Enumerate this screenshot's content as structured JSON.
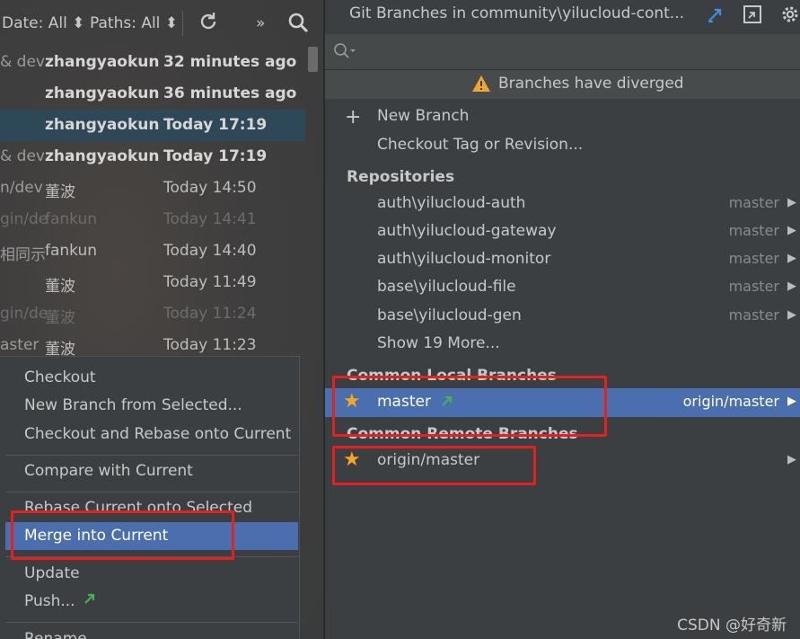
{
  "log": {
    "toolbar": {
      "date_filter": "Date: All ⬍",
      "paths_filter": "Paths: All ⬍",
      "more_glyph": "»"
    },
    "rows": [
      {
        "branch": "& dev",
        "author": "zhangyaokun",
        "date": "32 minutes ago",
        "style": "bold"
      },
      {
        "branch": "",
        "author": "zhangyaokun",
        "date": "36 minutes ago",
        "style": "bold"
      },
      {
        "branch": "",
        "author": "zhangyaokun",
        "date": "Today 17:19",
        "style": "bold"
      },
      {
        "branch": "& dev",
        "author": "zhangyaokun",
        "date": "Today 17:19",
        "style": "bold"
      },
      {
        "branch": "n/dev",
        "author": "董波",
        "date": "Today 14:50",
        "style": "normal"
      },
      {
        "branch": "gin/de",
        "author": "fankun",
        "date": "Today 14:41",
        "style": "dim"
      },
      {
        "branch": "相同示",
        "author": "fankun",
        "date": "Today 14:40",
        "style": "normal"
      },
      {
        "branch": "",
        "author": "董波",
        "date": "Today 11:49",
        "style": "normal"
      },
      {
        "branch": "gin/de",
        "author": "董波",
        "date": "Today 11:24",
        "style": "dim"
      },
      {
        "branch": "aster",
        "author": "董波",
        "date": "Today 11:23",
        "style": "normal"
      }
    ]
  },
  "context_menu": {
    "checkout": "Checkout",
    "new_branch_from_selected": "New Branch from Selected...",
    "checkout_and_rebase": "Checkout and Rebase onto Current",
    "compare_with_current": "Compare with Current",
    "rebase_current_onto_selected": "Rebase Current onto Selected",
    "merge_into_current": "Merge into Current",
    "update": "Update",
    "push": "Push...",
    "rename": "Rename..."
  },
  "branches_popup": {
    "title": "Git Branches in community\\yilucloud-cont...",
    "warning": "Branches have diverged",
    "new_branch": "New Branch",
    "checkout_tag": "Checkout Tag or Revision...",
    "repositories_header": "Repositories",
    "repositories": [
      {
        "name": "auth\\yilucloud-auth",
        "branch": "master"
      },
      {
        "name": "auth\\yilucloud-gateway",
        "branch": "master"
      },
      {
        "name": "auth\\yilucloud-monitor",
        "branch": "master"
      },
      {
        "name": "base\\yilucloud-file",
        "branch": "master"
      },
      {
        "name": "base\\yilucloud-gen",
        "branch": "master"
      }
    ],
    "show_more": "Show 19 More...",
    "local_header": "Common Local Branches",
    "local_branch": {
      "name": "master",
      "tracking": "origin/master"
    },
    "remote_header": "Common Remote Branches",
    "remote_branch": {
      "name": "origin/master"
    }
  },
  "watermark": "CSDN @好奇新",
  "colors": {
    "highlight": "#4b6eaf",
    "annotation_red": "#e8201d",
    "star": "#f5a623",
    "incoming_arrow": "#4caf50"
  }
}
